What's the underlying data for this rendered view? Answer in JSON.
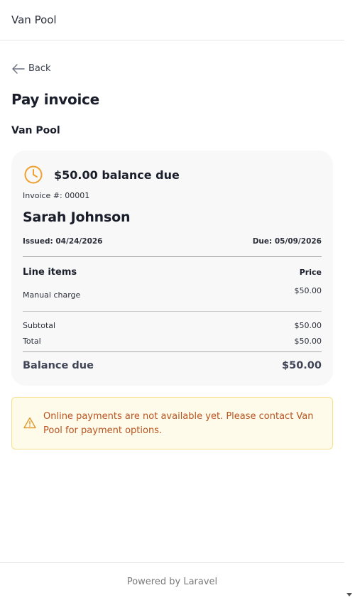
{
  "header": {
    "brand": "Van Pool"
  },
  "nav": {
    "back_label": "Back"
  },
  "page": {
    "title": "Pay invoice",
    "organization": "Van Pool"
  },
  "invoice": {
    "balance_due_heading": "$50.00 balance due",
    "invoice_number": "Invoice #: 00001",
    "customer_name": "Sarah Johnson",
    "issued": "Issued: 04/24/2026",
    "due": "Due: 05/09/2026",
    "line_items_header": "Line items",
    "price_header": "Price",
    "line_items": [
      {
        "description": "Manual charge",
        "price": "$50.00"
      }
    ],
    "subtotal_label": "Subtotal",
    "subtotal_value": "$50.00",
    "total_label": "Total",
    "total_value": "$50.00",
    "balance_due_label": "Balance due",
    "balance_due_value": "$50.00"
  },
  "alert": {
    "message": "Online payments are not available yet. Please contact Van Pool for payment options.",
    "icon": "warning-icon"
  },
  "footer": {
    "text": "Powered by Laravel"
  },
  "colors": {
    "accent_orange": "#f0a030",
    "alert_bg": "#fffbea",
    "alert_text": "#b8531f"
  }
}
